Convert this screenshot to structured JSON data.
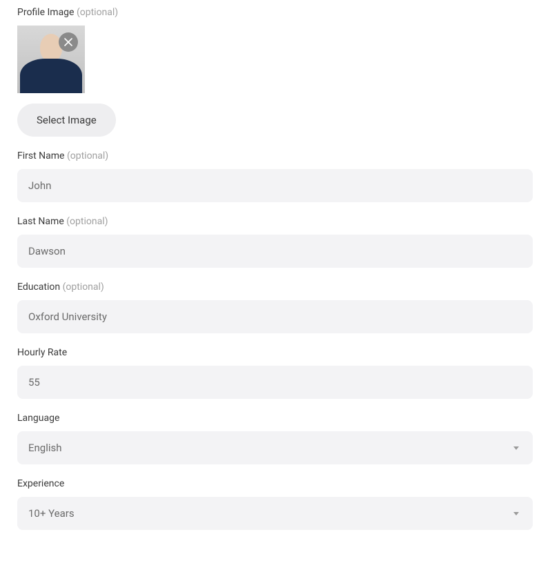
{
  "profileImage": {
    "label": "Profile Image",
    "optional": "(optional)",
    "selectButton": "Select Image"
  },
  "firstName": {
    "label": "First Name",
    "optional": "(optional)",
    "value": "John"
  },
  "lastName": {
    "label": "Last Name",
    "optional": "(optional)",
    "value": "Dawson"
  },
  "education": {
    "label": "Education",
    "optional": "(optional)",
    "value": "Oxford University"
  },
  "hourlyRate": {
    "label": "Hourly Rate",
    "value": "55"
  },
  "language": {
    "label": "Language",
    "value": "English"
  },
  "experience": {
    "label": "Experience",
    "value": "10+ Years"
  }
}
